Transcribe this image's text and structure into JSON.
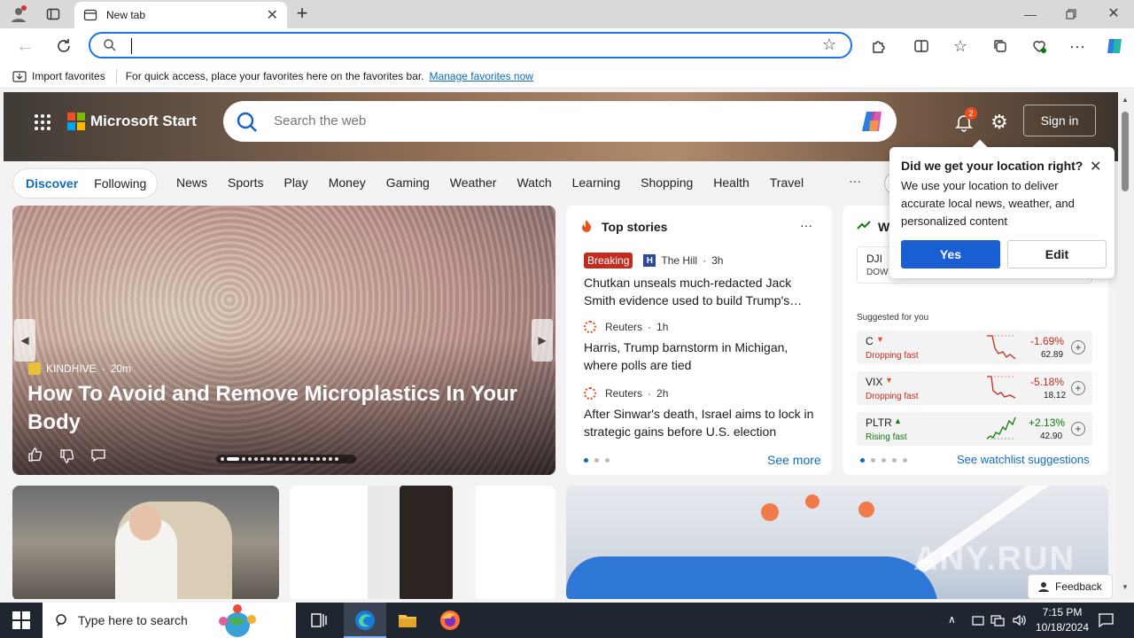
{
  "browser": {
    "tab_title": "New tab",
    "address_value": "",
    "import_favorites": "Import favorites",
    "favbar_hint": "For quick access, place your favorites here on the favorites bar.",
    "manage_favorites": "Manage favorites now"
  },
  "header": {
    "brand": "Microsoft Start",
    "search_placeholder": "Search the web",
    "notif_count": "2",
    "sign_in": "Sign in"
  },
  "nav": {
    "tabs": [
      "Discover",
      "Following"
    ],
    "items": [
      "News",
      "Sports",
      "Play",
      "Money",
      "Gaming",
      "Weather",
      "Watch",
      "Learning",
      "Shopping",
      "Health",
      "Travel"
    ],
    "more": "···"
  },
  "location_popup": {
    "title": "Did we get your location right?",
    "body": "We use your location to deliver accurate local news, weather, and personalized content",
    "yes": "Yes",
    "edit": "Edit"
  },
  "hero_story": {
    "source": "KINDHIVE",
    "age": "20m",
    "title": "How To Avoid and Remove Microplastics In Your Body"
  },
  "top_stories": {
    "heading": "Top stories",
    "items": [
      {
        "badge": "Breaking",
        "source": "The Hill",
        "age": "3h",
        "title": "Chutkan unseals much-redacted Jack Smith evidence used to build Trump's…"
      },
      {
        "badge": "",
        "source": "Reuters",
        "age": "1h",
        "title": "Harris, Trump barnstorm in Michigan, where polls are tied"
      },
      {
        "badge": "",
        "source": "Reuters",
        "age": "2h",
        "title": "After Sinwar's death, Israel aims to lock in strategic gains before U.S. election"
      }
    ],
    "see_more": "See more"
  },
  "watchlist": {
    "heading": "W",
    "index_symbol": "DJI",
    "index_name": "DOW",
    "suggested": "Suggested for you",
    "stocks": [
      {
        "symbol": "C",
        "status": "Dropping fast",
        "change": "-1.69%",
        "price": "62.89",
        "color": "#c42b1c"
      },
      {
        "symbol": "VIX",
        "status": "Dropping fast",
        "change": "-5.18%",
        "price": "18.12",
        "color": "#c42b1c"
      },
      {
        "symbol": "PLTR",
        "status": "Rising fast",
        "change": "+2.13%",
        "price": "42.90",
        "color": "#0e7a0d"
      }
    ],
    "see_watchlist": "See watchlist suggestions"
  },
  "feedback": "Feedback",
  "watermark": "ANY.RUN",
  "taskbar": {
    "search_placeholder": "Type here to search",
    "time": "7:15 PM",
    "date": "10/18/2024"
  },
  "colors": {
    "accent": "#0f6cbd",
    "primary_button": "#1a5fd1",
    "breaking": "#c42b1c"
  }
}
